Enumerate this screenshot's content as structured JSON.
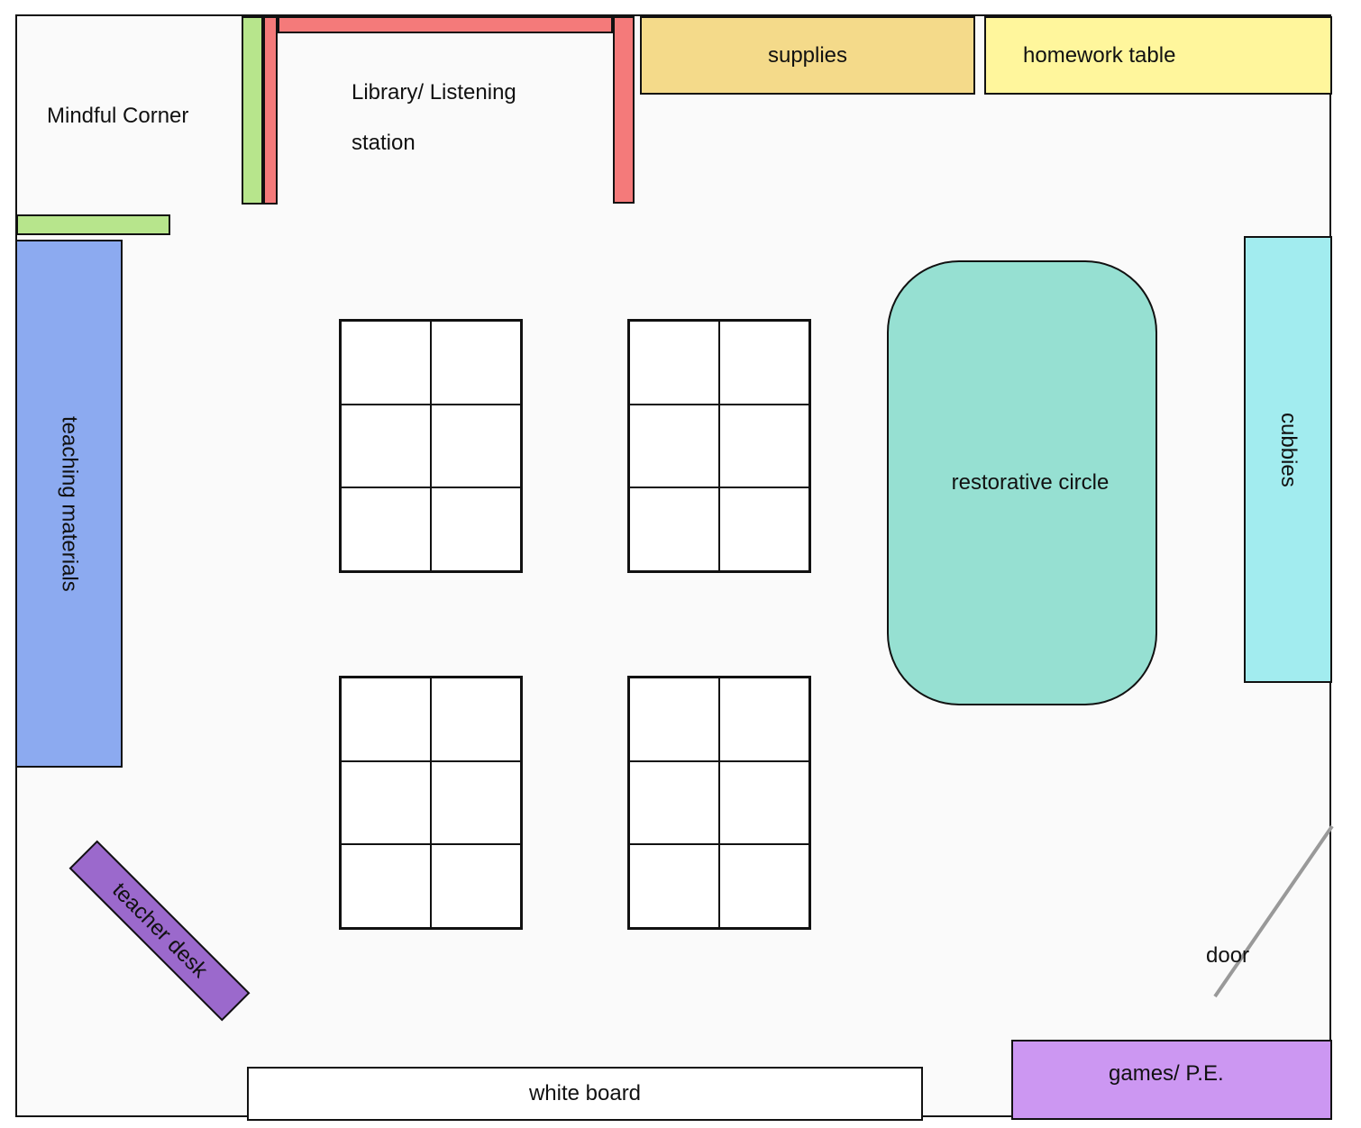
{
  "room": {
    "mindful_corner": "Mindful Corner",
    "library_line1": "Library/ Listening",
    "library_line2": "station",
    "supplies": "supplies",
    "homework_table": "homework table",
    "teaching_materials": "teaching materials",
    "restorative_circle": "restorative circle",
    "cubbies": "cubbies",
    "teacher_desk": "teacher desk",
    "door": "door",
    "white_board": "white board",
    "games_pe": "games/ P.E."
  },
  "colors": {
    "shelf_green": "#b7e58c",
    "shelf_red": "#f47a7a",
    "supplies": "#f4da8a",
    "homework": "#fff69c",
    "teaching": "#8caaf0",
    "restorative": "#96e0d2",
    "cubbies": "#a2ecef",
    "teacher_desk": "#9b69cc",
    "games": "#cc97f2",
    "door_line": "#999999"
  }
}
